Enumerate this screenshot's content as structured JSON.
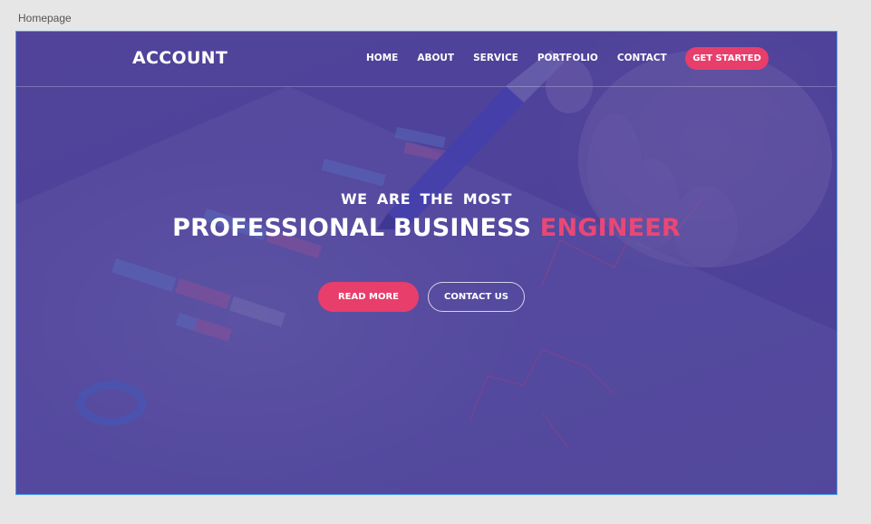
{
  "canvas": {
    "label": "Homepage"
  },
  "nav": {
    "logo": "ACCOUNT",
    "items": [
      {
        "label": "HOME"
      },
      {
        "label": "ABOUT"
      },
      {
        "label": "SERVICE"
      },
      {
        "label": "PORTFOLIO"
      },
      {
        "label": "CONTACT"
      }
    ],
    "cta": "GET STARTED"
  },
  "hero": {
    "subtitle": "WE  ARE  THE  MOST",
    "title_main": "PROFESSIONAL BUSINESS ",
    "title_accent": "ENGINEER",
    "primary_button": "READ MORE",
    "secondary_button": "CONTACT US"
  },
  "colors": {
    "accent": "#e83e6c",
    "overlay": "#483a96",
    "artboard_border": "#4a9be8"
  }
}
